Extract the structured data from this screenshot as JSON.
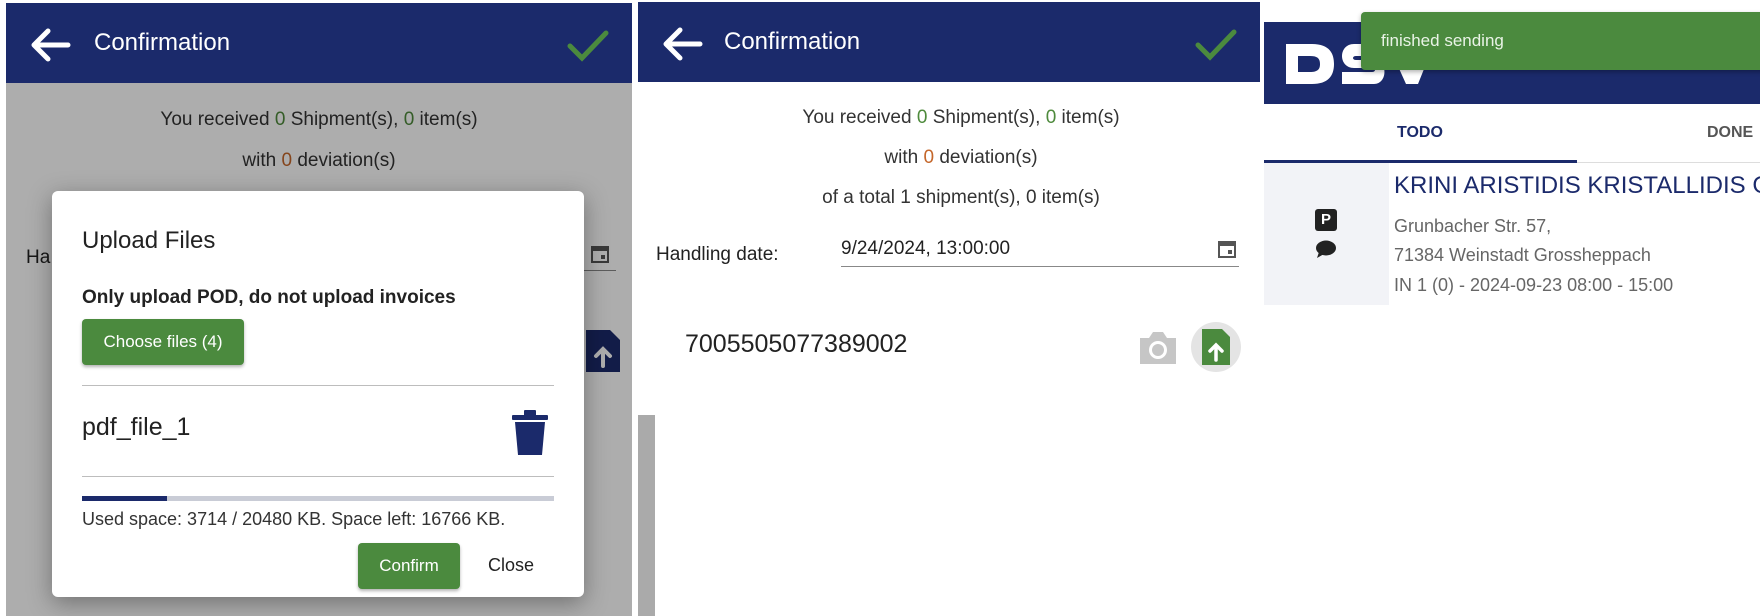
{
  "left_screen": {
    "header": {
      "title": "Confirmation"
    },
    "summary": {
      "received_prefix": "You received",
      "shipments_count": "0",
      "shipments_suffix": "Shipment(s),",
      "items_count": "0",
      "items_suffix": "item(s)",
      "with_prefix": "with",
      "deviations_count": "0",
      "deviations_suffix": "deviation(s)"
    },
    "handling_partial": "Ha",
    "dialog": {
      "title": "Upload Files",
      "warning": "Only upload POD, do not upload invoices",
      "choose_button": "Choose files (4)",
      "file_name": "pdf_file_1",
      "used_space": "Used space: 3714 / 20480 KB. Space left: 16766 KB.",
      "used_fraction": 0.181,
      "confirm_button": "Confirm",
      "close_button": "Close"
    }
  },
  "middle_screen": {
    "header": {
      "title": "Confirmation"
    },
    "summary": {
      "received_prefix": "You received",
      "shipments_count": "0",
      "shipments_suffix": "Shipment(s),",
      "items_count": "0",
      "items_suffix": "item(s)",
      "with_prefix": "with",
      "deviations_count": "0",
      "deviations_suffix": "deviation(s)",
      "total_line": "of a total 1 shipment(s), 0 item(s)"
    },
    "handling_label": "Handling date:",
    "handling_value": "9/24/2024, 13:00:00",
    "shipment_number": "7005505077389002"
  },
  "right_screen": {
    "toast": "finished sending",
    "tabs": [
      "TODO",
      "DONE"
    ],
    "company": "KRINI ARISTIDIS KRISTALLIDIS G",
    "address_line1": "Grunbacher Str. 57,",
    "address_line2": "71384 Weinstadt Grossheppach",
    "slot_line": "IN 1 (0) - 2024-09-23 08:00 - 15:00",
    "parking_badge": "P"
  },
  "colors": {
    "navy": "#1b2a6b",
    "green": "#4b8a3e",
    "count_green": "#4e8a3c",
    "count_orange": "#c4662a"
  },
  "icons": [
    "back-arrow-icon",
    "checkmark-icon",
    "calendar-icon",
    "trash-icon",
    "camera-icon",
    "file-upload-icon",
    "parking-icon",
    "chat-bubble-icon"
  ]
}
